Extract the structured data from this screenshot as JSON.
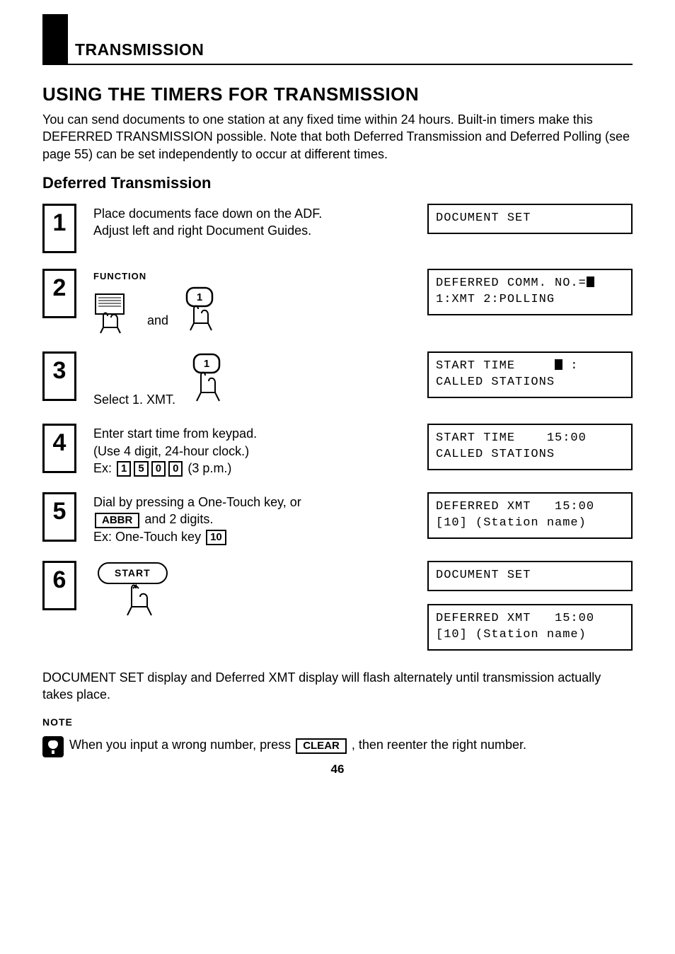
{
  "header": {
    "section": "TRANSMISSION"
  },
  "title": "USING THE TIMERS FOR TRANSMISSION",
  "intro": "You can send documents to one station at any fixed time within 24 hours. Built-in timers make this DEFERRED TRANSMISSION possible. Note that both Deferred Transmission and Deferred Polling (see page 55) can be set independently to occur at different times.",
  "subhead": "Deferred Transmission",
  "steps": [
    {
      "num": "1",
      "body_lines": [
        "Place documents face down on the ADF.",
        "Adjust left and right Document Guides."
      ],
      "displays": [
        {
          "lines": [
            "DOCUMENT SET"
          ]
        }
      ]
    },
    {
      "num": "2",
      "function_label": "FUNCTION",
      "and_label": "and",
      "key1_label": "1",
      "displays": [
        {
          "lines_raw": "DEFERRED COMM. NO.=█\n1:XMT 2:POLLING"
        }
      ]
    },
    {
      "num": "3",
      "body_lines": [
        "Select 1. XMT."
      ],
      "key1_label": "1",
      "displays": [
        {
          "lines_raw": "START TIME     █ :\nCALLED STATIONS"
        }
      ]
    },
    {
      "num": "4",
      "body_lines": [
        "Enter start time from keypad.",
        "(Use 4 digit, 24-hour clock.)"
      ],
      "ex_prefix": "Ex:",
      "ex_keys": [
        "1",
        "5",
        "0",
        "0"
      ],
      "ex_suffix": "(3 p.m.)",
      "displays": [
        {
          "lines_raw": "START TIME    15:00\nCALLED STATIONS"
        }
      ]
    },
    {
      "num": "5",
      "line1_a": "Dial by pressing a One-Touch key, or",
      "abbr_key": "ABBR",
      "line1_b": " and 2 digits.",
      "line2_a": "Ex: One-Touch key ",
      "line2_key": "10",
      "displays": [
        {
          "lines_raw": "DEFERRED XMT   15:00\n[10] (Station name)"
        }
      ]
    },
    {
      "num": "6",
      "start_label": "START",
      "displays": [
        {
          "lines": [
            "DOCUMENT SET"
          ]
        },
        {
          "lines_raw": "DEFERRED XMT   15:00\n[10] (Station name)"
        }
      ]
    }
  ],
  "footer": "DOCUMENT SET display and Deferred XMT display will flash alternately until transmission actually takes place.",
  "note": {
    "label": "NOTE",
    "text_a": "When you input a wrong number, press ",
    "clear_key": "CLEAR",
    "text_b": " , then reenter the right number."
  },
  "page_number": "46"
}
